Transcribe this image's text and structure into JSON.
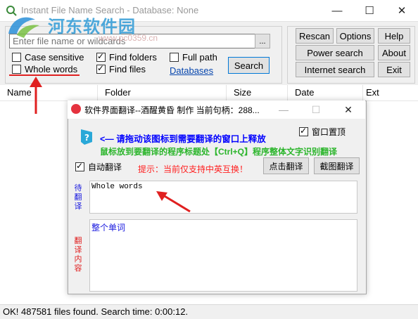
{
  "window": {
    "title": "Instant File Name Search - Database: None",
    "minimize_glyph": "—",
    "maximize_glyph": "☐",
    "close_glyph": "✕"
  },
  "watermark": {
    "text": "河东软件园",
    "url": "www.pc0359.cn"
  },
  "search": {
    "placeholder": "Enter file name or wildcards",
    "browse_label": "...",
    "case_sensitive": {
      "label": "Case sensitive",
      "checked": false
    },
    "whole_words": {
      "label": "Whole words",
      "checked": false
    },
    "find_folders": {
      "label": "Find folders",
      "checked": true
    },
    "find_files": {
      "label": "Find files",
      "checked": true
    },
    "full_path": {
      "label": "Full path",
      "checked": false
    },
    "databases_link": "Databases",
    "search_button": "Search"
  },
  "buttons": {
    "rescan": "Rescan",
    "options": "Options",
    "help": "Help",
    "power_search": "Power search",
    "about": "About",
    "internet_search": "Internet search",
    "exit": "Exit"
  },
  "columns": [
    "Name",
    "Folder",
    "Size",
    "Date",
    "Ext"
  ],
  "status": "OK! 487581 files found. Search time: 0:00:12.",
  "accent_colors": {
    "arrow": "#e02020",
    "title_blue": "#0000ff",
    "hint_green": "#2bb52b",
    "notice_red": "#ff2020"
  },
  "translator": {
    "title": "软件界面翻译--酒醒黄昏 制作   当前句柄：288...",
    "drag_instruction": "<— 请拖动该图标到需要翻译的窗口上释放",
    "topmost": {
      "label": "窗口置顶",
      "checked": true
    },
    "hint": "鼠标放到要翻译的程序标题处【Ctrl+Q】程序整体文字识别翻译",
    "auto_translate": {
      "label": "自动翻译",
      "checked": true
    },
    "support_notice": "提示：当前仅支持中英互换！",
    "click_translate_button": "点击翻译",
    "screenshot_translate_button": "截图翻译",
    "source_label": [
      "待",
      "翻",
      "译"
    ],
    "result_label": [
      "翻",
      "译",
      "内",
      "容"
    ],
    "source_text": "Whole words",
    "result_text": "整个单词"
  }
}
